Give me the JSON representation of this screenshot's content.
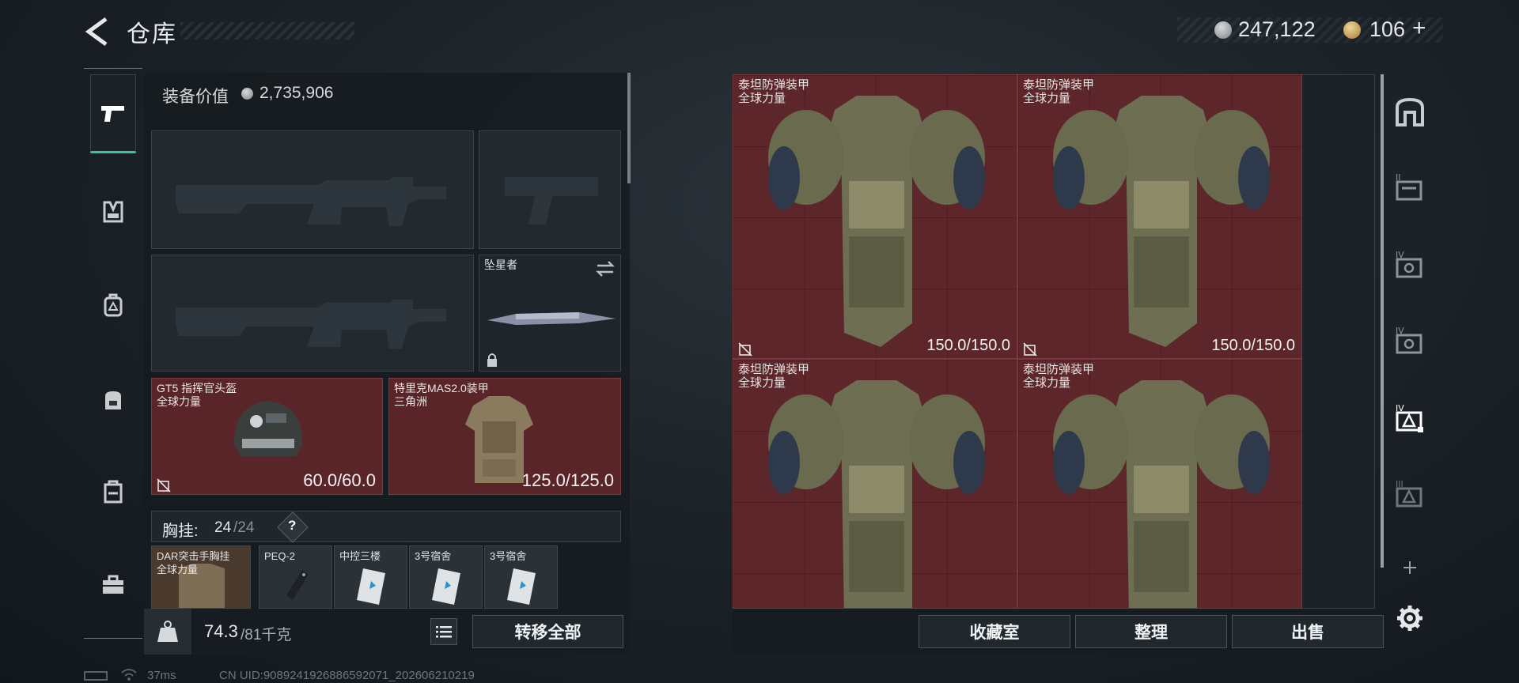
{
  "header": {
    "title": "仓库",
    "silver_amount": "247,122",
    "gold_amount": "106",
    "gold_plus": "+"
  },
  "nav": {
    "items": [
      "pistol-icon",
      "vest-icon",
      "backpack-icon",
      "backpack-alt-icon",
      "case-icon",
      "toolbox-icon"
    ],
    "active_index": 0
  },
  "loadout": {
    "value_label": "装备价值",
    "value": "2,735,906",
    "melee_name": "坠星者",
    "helmet": {
      "name": "GT5 指挥官头盔",
      "faction": "全球力量",
      "durability": "60.0/60.0"
    },
    "armor": {
      "name": "特里克MAS2.0装甲",
      "faction": "三角洲",
      "durability": "125.0/125.0"
    },
    "chest_label": "胸挂:",
    "chest_used": "24",
    "chest_total": "/24",
    "chest_help": "?",
    "items": [
      {
        "name": "DAR突击手胸挂",
        "faction": "全球力量"
      },
      {
        "name": "PEQ-2",
        "faction": ""
      },
      {
        "name": "中控三楼",
        "faction": ""
      },
      {
        "name": "3号宿舍",
        "faction": ""
      },
      {
        "name": "3号宿舍",
        "faction": ""
      }
    ],
    "weight_current": "74.3",
    "weight_max": "/81千克",
    "transfer_all": "转移全部"
  },
  "stash": {
    "cells": [
      {
        "name": "泰坦防弹装甲",
        "faction": "全球力量",
        "durability": "150.0/150.0"
      },
      {
        "name": "泰坦防弹装甲",
        "faction": "全球力量",
        "durability": "150.0/150.0"
      },
      {
        "name": "泰坦防弹装甲",
        "faction": "全球力量",
        "durability": ""
      },
      {
        "name": "泰坦防弹装甲",
        "faction": "全球力量",
        "durability": ""
      }
    ],
    "buttons": {
      "collection": "收藏室",
      "organize": "整理",
      "sell": "出售"
    }
  },
  "side_icons": [
    "home-icon",
    "stash-tab-2-icon",
    "stash-tab-4a-icon",
    "stash-tab-4b-icon",
    "stash-tab-4-selected-icon",
    "stash-tab-3-icon",
    "add-icon",
    "settings-icon"
  ],
  "status_bar": {
    "ping": "37ms",
    "uid": "CN UID:9089241926886592071_202606210219"
  },
  "colors": {
    "accent": "#35c49c",
    "item_red": "#5c262b",
    "panel": "#161c21"
  }
}
